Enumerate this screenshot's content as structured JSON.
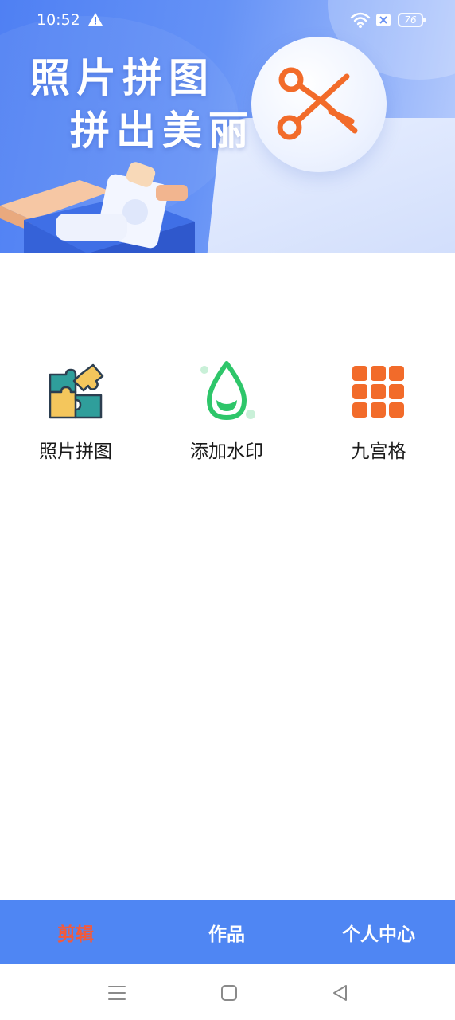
{
  "status_bar": {
    "time": "10:52",
    "battery": "76",
    "icons": [
      "alert-icon",
      "wifi-icon",
      "sim-icon",
      "battery-icon"
    ]
  },
  "banner": {
    "line1": "照片拼图",
    "line2": "拼出美丽",
    "icon": "scissors-icon"
  },
  "features": [
    {
      "label": "照片拼图",
      "icon": "puzzle-icon"
    },
    {
      "label": "添加水印",
      "icon": "water-drop-icon"
    },
    {
      "label": "九宫格",
      "icon": "grid-icon"
    }
  ],
  "tabs": [
    {
      "label": "剪辑",
      "active": true
    },
    {
      "label": "作品",
      "active": false
    },
    {
      "label": "个人中心",
      "active": false
    }
  ],
  "system_nav": [
    "menu-icon",
    "home-icon",
    "back-icon"
  ],
  "colors": {
    "banner_blue": "#4f80f3",
    "tab_bar_blue": "#4f86f3",
    "active_tab": "#f25a3c",
    "accent_orange": "#f26b2a",
    "accent_green": "#2ec66a"
  }
}
